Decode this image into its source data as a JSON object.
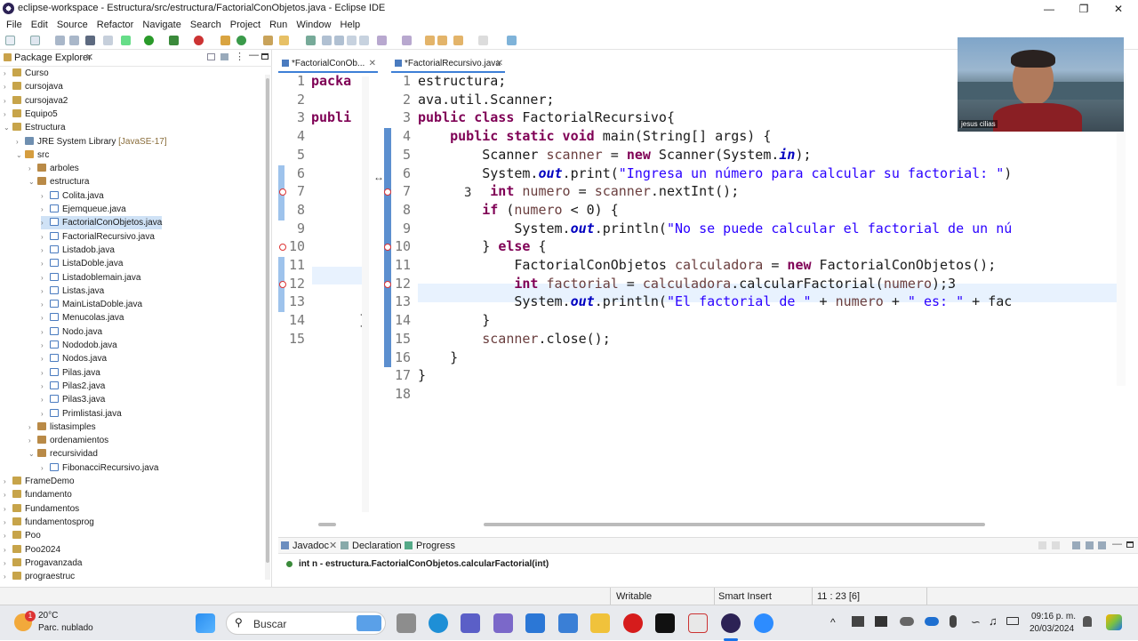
{
  "window": {
    "title": "eclipse-workspace - Estructura/src/estructura/FactorialConObjetos.java - Eclipse IDE"
  },
  "menu": [
    "File",
    "Edit",
    "Source",
    "Refactor",
    "Navigate",
    "Search",
    "Project",
    "Run",
    "Window",
    "Help"
  ],
  "package_explorer": {
    "title": "Package Explorer",
    "items": [
      {
        "label": "Curso",
        "depth": 0,
        "kind": "proj",
        "tw": ">"
      },
      {
        "label": "cursojava",
        "depth": 0,
        "kind": "proj",
        "tw": ">"
      },
      {
        "label": "cursojava2",
        "depth": 0,
        "kind": "proj",
        "tw": ">"
      },
      {
        "label": "Equipo5",
        "depth": 0,
        "kind": "proj",
        "tw": ">"
      },
      {
        "label": "Estructura",
        "depth": 0,
        "kind": "proj",
        "tw": "v"
      },
      {
        "label": "JRE System Library",
        "extra": "[JavaSE-17]",
        "depth": 1,
        "kind": "lib",
        "tw": ">"
      },
      {
        "label": "src",
        "depth": 1,
        "kind": "src",
        "tw": "v"
      },
      {
        "label": "arboles",
        "depth": 2,
        "kind": "pkg",
        "tw": ">"
      },
      {
        "label": "estructura",
        "depth": 2,
        "kind": "pkg",
        "tw": "v"
      },
      {
        "label": "Colita.java",
        "depth": 3,
        "kind": "java",
        "tw": ">"
      },
      {
        "label": "Ejemqueue.java",
        "depth": 3,
        "kind": "java",
        "tw": ">"
      },
      {
        "label": "FactorialConObjetos.java",
        "depth": 3,
        "kind": "java",
        "tw": ">",
        "selected": true
      },
      {
        "label": "FactorialRecursivo.java",
        "depth": 3,
        "kind": "java",
        "tw": ">"
      },
      {
        "label": "Listadob.java",
        "depth": 3,
        "kind": "java",
        "tw": ">"
      },
      {
        "label": "ListaDoble.java",
        "depth": 3,
        "kind": "java",
        "tw": ">"
      },
      {
        "label": "Listadoblemain.java",
        "depth": 3,
        "kind": "java",
        "tw": ">"
      },
      {
        "label": "Listas.java",
        "depth": 3,
        "kind": "java",
        "tw": ">"
      },
      {
        "label": "MainListaDoble.java",
        "depth": 3,
        "kind": "java",
        "tw": ">"
      },
      {
        "label": "Menucolas.java",
        "depth": 3,
        "kind": "java",
        "tw": ">"
      },
      {
        "label": "Nodo.java",
        "depth": 3,
        "kind": "java",
        "tw": ">"
      },
      {
        "label": "Nododob.java",
        "depth": 3,
        "kind": "java",
        "tw": ">"
      },
      {
        "label": "Nodos.java",
        "depth": 3,
        "kind": "java",
        "tw": ">"
      },
      {
        "label": "Pilas.java",
        "depth": 3,
        "kind": "java",
        "tw": ">"
      },
      {
        "label": "Pilas2.java",
        "depth": 3,
        "kind": "java",
        "tw": ">"
      },
      {
        "label": "Pilas3.java",
        "depth": 3,
        "kind": "java",
        "tw": ">"
      },
      {
        "label": "Primlistasi.java",
        "depth": 3,
        "kind": "java",
        "tw": ">"
      },
      {
        "label": "listasimples",
        "depth": 2,
        "kind": "pkg",
        "tw": ">"
      },
      {
        "label": "ordenamientos",
        "depth": 2,
        "kind": "pkg",
        "tw": ">"
      },
      {
        "label": "recursividad",
        "depth": 2,
        "kind": "pkg",
        "tw": "v"
      },
      {
        "label": "FibonacciRecursivo.java",
        "depth": 3,
        "kind": "java",
        "tw": ">"
      },
      {
        "label": "FrameDemo",
        "depth": 0,
        "kind": "proj",
        "tw": ">"
      },
      {
        "label": "fundamento",
        "depth": 0,
        "kind": "proj",
        "tw": ">"
      },
      {
        "label": "Fundamentos",
        "depth": 0,
        "kind": "proj",
        "tw": ">"
      },
      {
        "label": "fundamentosprog",
        "depth": 0,
        "kind": "proj",
        "tw": ">"
      },
      {
        "label": "Poo",
        "depth": 0,
        "kind": "proj",
        "tw": ">"
      },
      {
        "label": "Poo2024",
        "depth": 0,
        "kind": "proj",
        "tw": ">"
      },
      {
        "label": "Progavanzada",
        "depth": 0,
        "kind": "proj",
        "tw": ">"
      },
      {
        "label": "prograestruc",
        "depth": 0,
        "kind": "proj",
        "tw": ">"
      }
    ]
  },
  "editor1": {
    "tab": "*FactorialConOb...",
    "lines": [
      {
        "n": "1",
        "html": "<span class='kw'>packa</span>"
      },
      {
        "n": "2",
        "html": ""
      },
      {
        "n": "3",
        "html": "<span class='kw'>publi</span>"
      },
      {
        "n": "4",
        "html": ""
      },
      {
        "n": "5",
        "html": ""
      },
      {
        "n": "6",
        "html": ""
      },
      {
        "n": "7",
        "html": ""
      },
      {
        "n": "8",
        "html": ""
      },
      {
        "n": "9",
        "html": ""
      },
      {
        "n": "10",
        "html": ""
      },
      {
        "n": "11",
        "html": ""
      },
      {
        "n": "12",
        "html": ""
      },
      {
        "n": "13",
        "html": ""
      },
      {
        "n": "14",
        "html": "      }"
      },
      {
        "n": "15",
        "html": ""
      }
    ]
  },
  "editor2": {
    "tab": "*FactorialRecursivo.java",
    "lines": [
      {
        "n": "1",
        "html": "estructura;"
      },
      {
        "n": "2",
        "html": "ava.util.Scanner;"
      },
      {
        "n": "3",
        "html": "<span class='kw'>public class</span> FactorialRecursivo{"
      },
      {
        "n": "4",
        "html": "    <span class='kw'>public static void</span> main(String[] args) {"
      },
      {
        "n": "5",
        "html": "        Scanner <span class='var'>scanner</span> = <span class='kw'>new</span> Scanner(System.<span class='fld'>in</span>);"
      },
      {
        "n": "6",
        "html": "        System.<span class='fld'>out</span>.print(<span class='str'>\"Ingresa un número para calcular su factorial: \"</span>)"
      },
      {
        "n": "7",
        "html": "         <span class='kw'>int</span> <span class='var'>numero</span> = <span class='var'>scanner</span>.nextInt();"
      },
      {
        "n": "8",
        "html": "        <span class='kw'>if</span> (<span class='var'>numero</span> &lt; 0) {"
      },
      {
        "n": "9",
        "html": "            System.<span class='fld'>out</span>.println(<span class='str'>\"No se puede calcular el factorial de un nú</span>"
      },
      {
        "n": "10",
        "html": "        } <span class='kw'>else</span> {"
      },
      {
        "n": "11",
        "html": "            FactorialConObjetos <span class='var'>calculadora</span> = <span class='kw'>new</span> FactorialConObjetos();"
      },
      {
        "n": "12",
        "html": "            <span class='kw'>int</span> <span class='var'>factorial</span> = <span class='var'>calculadora</span>.calcularFactorial(<span class='var'>numero</span>);3"
      },
      {
        "n": "13",
        "html": "            System.<span class='fld'>out</span>.println(<span class='str'>\"El factorial de \"</span> + <span class='var'>numero</span> + <span class='str'>\" es: \"</span> + fac"
      },
      {
        "n": "14",
        "html": "        }"
      },
      {
        "n": "15",
        "html": "        <span class='var'>scanner</span>.close();"
      },
      {
        "n": "16",
        "html": "    }"
      },
      {
        "n": "17",
        "html": "}"
      },
      {
        "n": "18",
        "html": ""
      }
    ],
    "typed_digit": "3"
  },
  "bottom": {
    "tabs": [
      "Javadoc",
      "Declaration",
      "Progress"
    ],
    "javadoc_text": "int n - estructura.FactorialConObjetos.calcularFactorial(int)"
  },
  "status": {
    "writable": "Writable",
    "insert": "Smart Insert",
    "position": "11 : 23 [6]"
  },
  "webcam": {
    "name": "jesus cilias"
  },
  "taskbar": {
    "weather_temp": "20°C",
    "weather_desc": "Parc. nublado",
    "weather_badge": "1",
    "search_placeholder": "Buscar",
    "time": "09:16 p. m.",
    "date": "20/03/2024",
    "tray_up": "^"
  }
}
